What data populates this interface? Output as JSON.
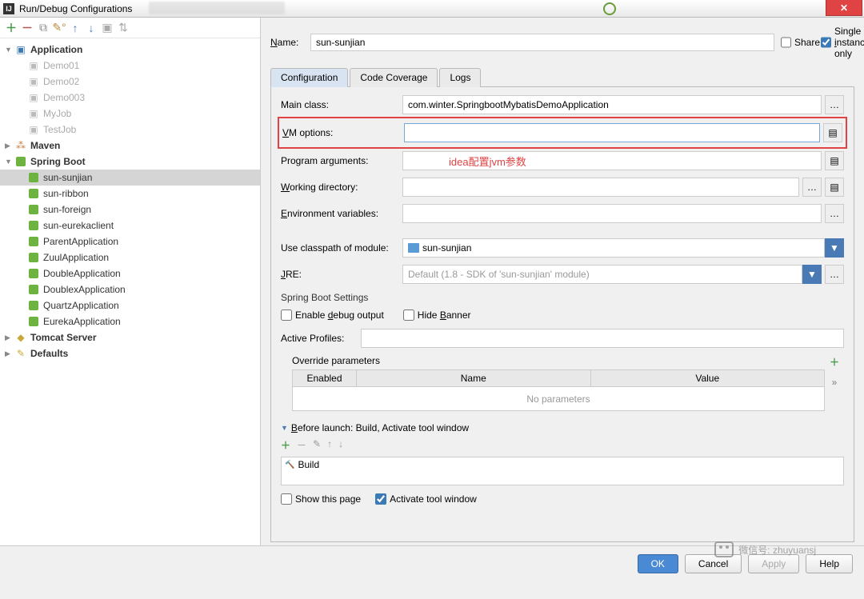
{
  "title": "Run/Debug Configurations",
  "toolbar_icons": [
    "+",
    "−",
    "⧉",
    "⚙",
    "↑",
    "↓",
    "▣",
    "⇅"
  ],
  "tree": {
    "application": {
      "label": "Application",
      "items": [
        "Demo01",
        "Demo02",
        "Demo003",
        "MyJob",
        "TestJob"
      ]
    },
    "maven": {
      "label": "Maven"
    },
    "springboot": {
      "label": "Spring Boot",
      "items": [
        "sun-sunjian",
        "sun-ribbon",
        "sun-foreign",
        "sun-eurekaclient",
        "ParentApplication",
        "ZuulApplication",
        "DoubleApplication",
        "DoublexApplication",
        "QuartzApplication",
        "EurekaApplication"
      ]
    },
    "tomcat": {
      "label": "Tomcat Server"
    },
    "defaults": {
      "label": "Defaults"
    }
  },
  "name_label": "Name:",
  "name_value": "sun-sunjian",
  "share_label": "Share",
  "single_label": "Single instance only",
  "tabs": [
    "Configuration",
    "Code Coverage",
    "Logs"
  ],
  "fields": {
    "main_class": {
      "label": "Main class:",
      "value": "com.winter.SpringbootMybatisDemoApplication"
    },
    "vm": {
      "label": "VM options:",
      "value": ""
    },
    "args": {
      "label": "Program arguments:",
      "value": ""
    },
    "wd": {
      "label": "Working directory:",
      "value": ""
    },
    "env": {
      "label": "Environment variables:",
      "value": ""
    },
    "cp": {
      "label": "Use classpath of module:",
      "value": "sun-sunjian"
    },
    "jre": {
      "label": "JRE:",
      "value": "Default (1.8 - SDK of 'sun-sunjian' module)",
      "prefix": "Default "
    }
  },
  "annotation": "idea配置jvm参数",
  "sb_section": "Spring Boot Settings",
  "enable_debug": "Enable debug output",
  "hide_banner": "Hide Banner",
  "active_profiles": "Active Profiles:",
  "override": {
    "title": "Override parameters",
    "cols": [
      "Enabled",
      "Name",
      "Value"
    ],
    "empty": "No parameters"
  },
  "before": {
    "title": "Before launch: Build, Activate tool window",
    "build": "Build"
  },
  "show_page": "Show this page",
  "activate_tw": "Activate tool window",
  "buttons": {
    "ok": "OK",
    "cancel": "Cancel",
    "apply": "Apply",
    "help": "Help"
  },
  "watermark": "微信号: zhuyuansj"
}
